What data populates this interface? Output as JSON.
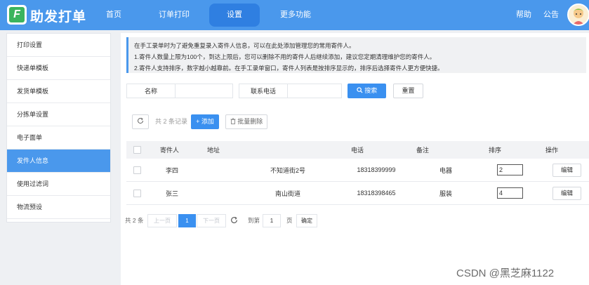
{
  "app": {
    "logo_letter": "F",
    "brand": "助发打单"
  },
  "nav": {
    "items": [
      "首页",
      "订单打印",
      "设置",
      "更多功能"
    ],
    "active": "设置",
    "help": "帮助",
    "notice": "公告"
  },
  "sidebar": {
    "items": [
      "打印设置",
      "快递单模板",
      "发货单模板",
      "分拣单设置",
      "电子面单",
      "发件人信息",
      "使用过滤词",
      "物流预设"
    ],
    "active": "发件人信息"
  },
  "notice": {
    "line1": "在手工录单时为了避免重复录入寄件人信息，可以在此处添加管理您的常用寄件人。",
    "line2": "1.寄件人数量上限为100个，到达上限后，您可以删除不用的寄件人后继续添加，建议您定期清理维护您的寄件人。",
    "line3": "2.寄件人支持排序，数字越小越靠前。在手工录单窗口，寄件人列表是按排序显示的，排序后选择寄件人更方便快捷。"
  },
  "search": {
    "name_label": "名称",
    "name_value": "",
    "phone_label": "联系电话",
    "phone_value": "",
    "search_button": "搜索",
    "reset_button": "重置"
  },
  "toolbar": {
    "count_text": "共 2 条记录",
    "add_button": "添加",
    "batch_delete_button": "批量删除"
  },
  "table": {
    "headers": {
      "sender": "寄件人",
      "address": "地址",
      "phone": "电话",
      "remark": "备注",
      "sort": "排序",
      "action": "操作"
    },
    "rows": [
      {
        "sender": "李四",
        "address": "不知道街2号",
        "phone": "18318399999",
        "remark": "电器",
        "sort": "2",
        "action": "编辑"
      },
      {
        "sender": "张三",
        "address": "南山街道",
        "phone": "18318398465",
        "remark": "服装",
        "sort": "4",
        "action": "编辑"
      }
    ]
  },
  "pagination": {
    "total": "共 2 条",
    "prev": "上一页",
    "current": "1",
    "next": "下一页",
    "goto_label": "到第",
    "goto_value": "1",
    "page_unit": "页",
    "confirm": "确定"
  },
  "watermark": "CSDN @黑芝麻1122",
  "colors": {
    "primary": "#4a98ec",
    "nav_active": "#2f7fe1",
    "button": "#3a90f0",
    "logo_green": "#3bb45e"
  }
}
